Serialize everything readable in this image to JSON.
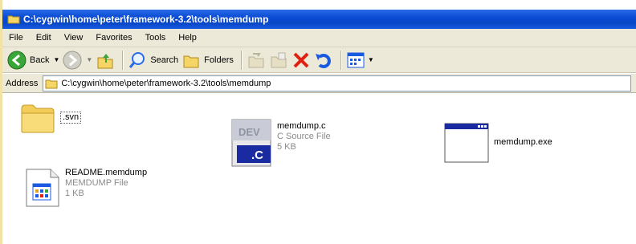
{
  "window": {
    "title": "C:\\cygwin\\home\\peter\\framework-3.2\\tools\\memdump"
  },
  "menu": [
    "File",
    "Edit",
    "View",
    "Favorites",
    "Tools",
    "Help"
  ],
  "toolbar": {
    "back": "Back",
    "search": "Search",
    "folders": "Folders"
  },
  "address": {
    "label": "Address",
    "value": "C:\\cygwin\\home\\peter\\framework-3.2\\tools\\memdump"
  },
  "files": [
    {
      "name": ".svn",
      "icon": "folder-icon"
    },
    {
      "name": "memdump.c",
      "type": "C Source File",
      "size": "5 KB",
      "icon": "c-source-file-icon"
    },
    {
      "name": "memdump.exe",
      "icon": "application-window-icon"
    },
    {
      "name": "README.memdump",
      "type": "MEMDUMP File",
      "size": "1 KB",
      "icon": "generic-file-icon"
    }
  ],
  "colors": {
    "titlebar": "#0a4bd4",
    "chrome": "#ece9d8",
    "desktop": "#f3e2a6"
  }
}
